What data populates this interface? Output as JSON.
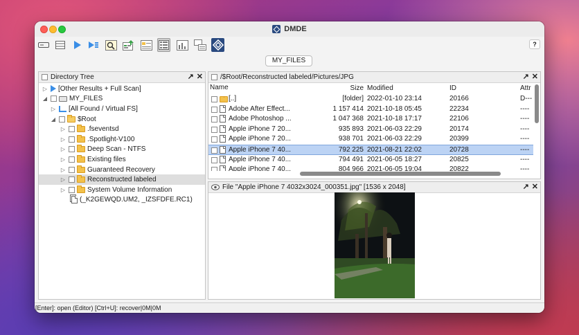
{
  "app": {
    "title": "DMDE"
  },
  "toolbar": {
    "help_label": "?",
    "buttons": [
      {
        "icon": "drive-icon"
      },
      {
        "icon": "list-icon"
      },
      {
        "icon": "play-icon"
      },
      {
        "icon": "play-list-icon"
      },
      {
        "icon": "search-file-icon"
      },
      {
        "icon": "recover-icon"
      },
      {
        "icon": "folder-view-icon"
      },
      {
        "icon": "grid-view-icon",
        "pressed": true
      },
      {
        "icon": "chart-icon"
      },
      {
        "icon": "copy-icon"
      },
      {
        "icon": "dmde-logo-icon"
      }
    ]
  },
  "tab": {
    "label": "MY_FILES"
  },
  "tree": {
    "title": "Directory Tree",
    "items": [
      {
        "label": "[Other Results + Full Scan]"
      },
      {
        "label": "MY_FILES"
      },
      {
        "label": "[All Found / Virtual FS]"
      },
      {
        "label": "$Root"
      },
      {
        "label": ".fseventsd"
      },
      {
        "label": ".Spotlight-V100"
      },
      {
        "label": "Deep Scan - NTFS"
      },
      {
        "label": "Existing files"
      },
      {
        "label": "Guaranteed Recovery"
      },
      {
        "label": "Reconstructed labeled",
        "selected": true
      },
      {
        "label": "System Volume Information"
      },
      {
        "label": "(_K2GEWQD.UM2, _IZSFDFE.RC1)"
      }
    ]
  },
  "files": {
    "path": "/$Root/Reconstructed labeled/Pictures/JPG",
    "columns": {
      "name": "Name",
      "size": "Size",
      "modified": "Modified",
      "id": "ID",
      "attr": "Attr"
    },
    "rows": [
      {
        "name": "[..]",
        "size": "[folder]",
        "modified": "2022-01-10 23:14",
        "id": "20166",
        "attr": "D---"
      },
      {
        "name": "Adobe After Effect...",
        "size": "1 157 414",
        "modified": "2021-10-18 05:45",
        "id": "22234",
        "attr": "----"
      },
      {
        "name": "Adobe Photoshop ...",
        "size": "1 047 368",
        "modified": "2021-10-18 17:17",
        "id": "22106",
        "attr": "----"
      },
      {
        "name": "Apple iPhone 7 20...",
        "size": "935 893",
        "modified": "2021-06-03 22:29",
        "id": "20174",
        "attr": "----"
      },
      {
        "name": "Apple iPhone 7 20...",
        "size": "938 701",
        "modified": "2021-06-03 22:29",
        "id": "20399",
        "attr": "----"
      },
      {
        "name": "Apple iPhone 7 40...",
        "size": "792 225",
        "modified": "2021-08-21 22:02",
        "id": "20728",
        "attr": "----",
        "selected": true
      },
      {
        "name": "Apple iPhone 7 40...",
        "size": "794 491",
        "modified": "2021-06-05 18:27",
        "id": "20825",
        "attr": "----"
      },
      {
        "name": "Apple iPhone 7 40...",
        "size": "804 966",
        "modified": "2021-06-05 19:04",
        "id": "20822",
        "attr": "----"
      }
    ]
  },
  "preview": {
    "title": "File \"Apple iPhone 7 4032x3024_000351.jpg\" [1536 x 2048]"
  },
  "status": {
    "text": "[Enter]: open (Editor)  [Ctrl+U]: recover|0M|0M"
  }
}
